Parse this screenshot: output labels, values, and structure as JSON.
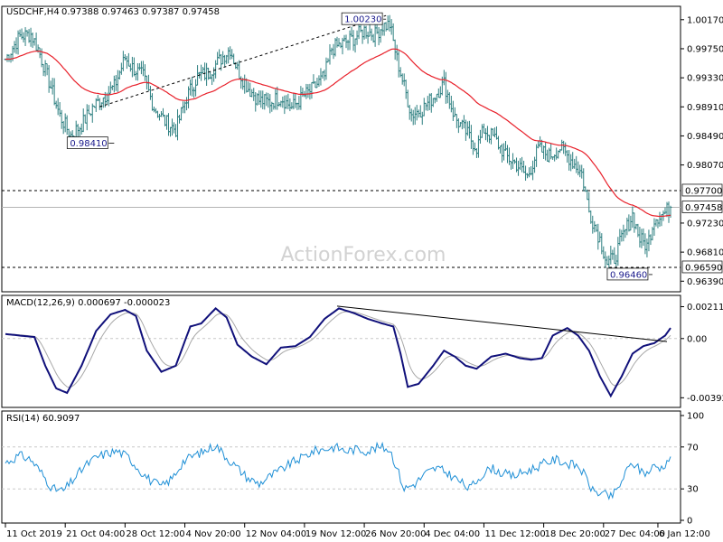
{
  "chart_data": {
    "type": "candlestick",
    "price_panel": {
      "symbol_label": "USDCHF,H4",
      "ohlc_label": "0.97388 0.97463 0.97387 0.97458",
      "watermark": "ActionForex.com",
      "ylim": [
        0.9625,
        1.0035
      ],
      "y_ticks": [
        1.0017,
        0.9975,
        0.9933,
        0.9891,
        0.9849,
        0.9807,
        0.9723,
        0.9681,
        0.9639
      ],
      "y_tick_labels": [
        "1.00170",
        "0.99750",
        "0.99330",
        "0.98910",
        "0.98490",
        "0.98070",
        "0.97230",
        "0.96810",
        "0.96390"
      ],
      "current_price": 0.97458,
      "current_price_label": "0.97458",
      "levels": [
        {
          "value": 0.977,
          "label": "0.97700"
        },
        {
          "value": 0.9659,
          "label": "0.96590"
        }
      ],
      "annotations": [
        {
          "bar": 60,
          "value": 0.9841,
          "label": "0.98410"
        },
        {
          "bar": 210,
          "value": 1.0023,
          "label": "1.00230"
        },
        {
          "bar": 357,
          "value": 0.9646,
          "label": "0.96460"
        }
      ],
      "trendline": {
        "from": {
          "bar": 52,
          "value": 0.9891
        },
        "to": {
          "bar": 210,
          "value": 1.0023
        }
      },
      "ema_color": "#e8202a",
      "bar_color": "#2d7f80",
      "close_series": [
        {
          "bar": 0,
          "value": 0.996
        },
        {
          "bar": 8,
          "value": 0.9993
        },
        {
          "bar": 14,
          "value": 0.9996
        },
        {
          "bar": 18,
          "value": 0.9975
        },
        {
          "bar": 24,
          "value": 0.9928
        },
        {
          "bar": 30,
          "value": 0.9878
        },
        {
          "bar": 36,
          "value": 0.985
        },
        {
          "bar": 42,
          "value": 0.9865
        },
        {
          "bar": 48,
          "value": 0.989
        },
        {
          "bar": 54,
          "value": 0.9905
        },
        {
          "bar": 60,
          "value": 0.992
        },
        {
          "bar": 66,
          "value": 0.9962
        },
        {
          "bar": 70,
          "value": 0.9948
        },
        {
          "bar": 76,
          "value": 0.9935
        },
        {
          "bar": 82,
          "value": 0.989
        },
        {
          "bar": 88,
          "value": 0.987
        },
        {
          "bar": 94,
          "value": 0.9858
        },
        {
          "bar": 100,
          "value": 0.9905
        },
        {
          "bar": 106,
          "value": 0.9935
        },
        {
          "bar": 112,
          "value": 0.994
        },
        {
          "bar": 118,
          "value": 0.9958
        },
        {
          "bar": 124,
          "value": 0.9975
        },
        {
          "bar": 128,
          "value": 0.9945
        },
        {
          "bar": 134,
          "value": 0.9918
        },
        {
          "bar": 140,
          "value": 0.99
        },
        {
          "bar": 146,
          "value": 0.9898
        },
        {
          "bar": 152,
          "value": 0.9905
        },
        {
          "bar": 158,
          "value": 0.989
        },
        {
          "bar": 164,
          "value": 0.9905
        },
        {
          "bar": 170,
          "value": 0.9918
        },
        {
          "bar": 176,
          "value": 0.9935
        },
        {
          "bar": 180,
          "value": 0.9975
        },
        {
          "bar": 186,
          "value": 0.9982
        },
        {
          "bar": 192,
          "value": 0.999
        },
        {
          "bar": 198,
          "value": 1.0002
        },
        {
          "bar": 204,
          "value": 0.9995
        },
        {
          "bar": 208,
          "value": 1.0008
        },
        {
          "bar": 212,
          "value": 1.001
        },
        {
          "bar": 216,
          "value": 0.996
        },
        {
          "bar": 220,
          "value": 0.992
        },
        {
          "bar": 224,
          "value": 0.988
        },
        {
          "bar": 230,
          "value": 0.9888
        },
        {
          "bar": 236,
          "value": 0.9905
        },
        {
          "bar": 242,
          "value": 0.9925
        },
        {
          "bar": 248,
          "value": 0.9875
        },
        {
          "bar": 254,
          "value": 0.9855
        },
        {
          "bar": 260,
          "value": 0.9832
        },
        {
          "bar": 264,
          "value": 0.9858
        },
        {
          "bar": 270,
          "value": 0.9845
        },
        {
          "bar": 276,
          "value": 0.982
        },
        {
          "bar": 282,
          "value": 0.9808
        },
        {
          "bar": 288,
          "value": 0.979
        },
        {
          "bar": 294,
          "value": 0.983
        },
        {
          "bar": 300,
          "value": 0.982
        },
        {
          "bar": 306,
          "value": 0.9832
        },
        {
          "bar": 312,
          "value": 0.9815
        },
        {
          "bar": 318,
          "value": 0.9795
        },
        {
          "bar": 322,
          "value": 0.974
        },
        {
          "bar": 328,
          "value": 0.97
        },
        {
          "bar": 332,
          "value": 0.9665
        },
        {
          "bar": 336,
          "value": 0.9672
        },
        {
          "bar": 340,
          "value": 0.97
        },
        {
          "bar": 346,
          "value": 0.9735
        },
        {
          "bar": 350,
          "value": 0.97
        },
        {
          "bar": 354,
          "value": 0.969
        },
        {
          "bar": 358,
          "value": 0.973
        },
        {
          "bar": 364,
          "value": 0.9738
        },
        {
          "bar": 367,
          "value": 0.97458
        }
      ]
    },
    "macd_panel": {
      "label": "MACD(12,26,9) 0.000697 -0.000023",
      "ylim": [
        -0.0045,
        0.0028
      ],
      "y_tick_labels": [
        "0.002113",
        "0.00",
        "-0.003922"
      ],
      "y_ticks": [
        0.002113,
        0.0,
        -0.003922
      ],
      "macd_line_color": "#10107a",
      "signal_line_color": "#a8a8a8",
      "trendline": {
        "from": {
          "bar": 183,
          "value": 0.00215
        },
        "to": {
          "bar": 365,
          "value": -0.0002
        }
      },
      "macd_series": [
        {
          "bar": 0,
          "value": 0.0003
        },
        {
          "bar": 8,
          "value": 0.0002
        },
        {
          "bar": 16,
          "value": 0.0001
        },
        {
          "bar": 22,
          "value": -0.0018
        },
        {
          "bar": 28,
          "value": -0.0033
        },
        {
          "bar": 34,
          "value": -0.0036
        },
        {
          "bar": 42,
          "value": -0.0018
        },
        {
          "bar": 50,
          "value": 0.0005
        },
        {
          "bar": 58,
          "value": 0.0016
        },
        {
          "bar": 66,
          "value": 0.0019
        },
        {
          "bar": 72,
          "value": 0.0015
        },
        {
          "bar": 78,
          "value": -0.0008
        },
        {
          "bar": 86,
          "value": -0.0022
        },
        {
          "bar": 94,
          "value": -0.0018
        },
        {
          "bar": 102,
          "value": 0.0008
        },
        {
          "bar": 108,
          "value": 0.001
        },
        {
          "bar": 116,
          "value": 0.002
        },
        {
          "bar": 122,
          "value": 0.0014
        },
        {
          "bar": 128,
          "value": -0.0004
        },
        {
          "bar": 136,
          "value": -0.0012
        },
        {
          "bar": 144,
          "value": -0.0017
        },
        {
          "bar": 152,
          "value": -0.0006
        },
        {
          "bar": 160,
          "value": -0.0005
        },
        {
          "bar": 168,
          "value": 0.0001
        },
        {
          "bar": 176,
          "value": 0.0013
        },
        {
          "bar": 184,
          "value": 0.002
        },
        {
          "bar": 192,
          "value": 0.0017
        },
        {
          "bar": 200,
          "value": 0.0013
        },
        {
          "bar": 208,
          "value": 0.001
        },
        {
          "bar": 214,
          "value": 0.0008
        },
        {
          "bar": 218,
          "value": -0.001
        },
        {
          "bar": 222,
          "value": -0.0032
        },
        {
          "bar": 228,
          "value": -0.003
        },
        {
          "bar": 236,
          "value": -0.0018
        },
        {
          "bar": 242,
          "value": -0.0008
        },
        {
          "bar": 248,
          "value": -0.0012
        },
        {
          "bar": 254,
          "value": -0.0018
        },
        {
          "bar": 260,
          "value": -0.002
        },
        {
          "bar": 268,
          "value": -0.0012
        },
        {
          "bar": 276,
          "value": -0.001
        },
        {
          "bar": 284,
          "value": -0.0013
        },
        {
          "bar": 290,
          "value": -0.0014
        },
        {
          "bar": 296,
          "value": -0.0013
        },
        {
          "bar": 302,
          "value": 0.0002
        },
        {
          "bar": 310,
          "value": 0.0007
        },
        {
          "bar": 316,
          "value": 0.0002
        },
        {
          "bar": 322,
          "value": -0.0008
        },
        {
          "bar": 328,
          "value": -0.0025
        },
        {
          "bar": 334,
          "value": -0.0038
        },
        {
          "bar": 340,
          "value": -0.0025
        },
        {
          "bar": 346,
          "value": -0.001
        },
        {
          "bar": 352,
          "value": -0.0005
        },
        {
          "bar": 358,
          "value": -0.0003
        },
        {
          "bar": 364,
          "value": 0.0002
        },
        {
          "bar": 367,
          "value": 0.000697
        }
      ]
    },
    "rsi_panel": {
      "label": "RSI(14) 60.9097",
      "ylim": [
        0,
        100
      ],
      "y_ticks": [
        100,
        70,
        30,
        0
      ],
      "y_tick_labels": [
        "100",
        "70",
        "30",
        "0"
      ],
      "dashed_levels": [
        70,
        30
      ],
      "line_color": "#1e8fd6",
      "rsi_series": [
        {
          "bar": 0,
          "value": 55
        },
        {
          "bar": 8,
          "value": 62
        },
        {
          "bar": 14,
          "value": 58
        },
        {
          "bar": 20,
          "value": 45
        },
        {
          "bar": 26,
          "value": 30
        },
        {
          "bar": 32,
          "value": 28
        },
        {
          "bar": 38,
          "value": 40
        },
        {
          "bar": 44,
          "value": 52
        },
        {
          "bar": 50,
          "value": 60
        },
        {
          "bar": 56,
          "value": 64
        },
        {
          "bar": 62,
          "value": 66
        },
        {
          "bar": 68,
          "value": 60
        },
        {
          "bar": 74,
          "value": 48
        },
        {
          "bar": 80,
          "value": 38
        },
        {
          "bar": 86,
          "value": 32
        },
        {
          "bar": 92,
          "value": 40
        },
        {
          "bar": 98,
          "value": 56
        },
        {
          "bar": 104,
          "value": 62
        },
        {
          "bar": 110,
          "value": 66
        },
        {
          "bar": 116,
          "value": 72
        },
        {
          "bar": 122,
          "value": 60
        },
        {
          "bar": 128,
          "value": 50
        },
        {
          "bar": 134,
          "value": 40
        },
        {
          "bar": 140,
          "value": 35
        },
        {
          "bar": 146,
          "value": 42
        },
        {
          "bar": 152,
          "value": 48
        },
        {
          "bar": 158,
          "value": 55
        },
        {
          "bar": 164,
          "value": 60
        },
        {
          "bar": 170,
          "value": 66
        },
        {
          "bar": 176,
          "value": 68
        },
        {
          "bar": 182,
          "value": 70
        },
        {
          "bar": 188,
          "value": 66
        },
        {
          "bar": 194,
          "value": 68
        },
        {
          "bar": 200,
          "value": 66
        },
        {
          "bar": 206,
          "value": 70
        },
        {
          "bar": 212,
          "value": 68
        },
        {
          "bar": 216,
          "value": 50
        },
        {
          "bar": 220,
          "value": 30
        },
        {
          "bar": 226,
          "value": 35
        },
        {
          "bar": 232,
          "value": 45
        },
        {
          "bar": 238,
          "value": 50
        },
        {
          "bar": 244,
          "value": 45
        },
        {
          "bar": 250,
          "value": 38
        },
        {
          "bar": 256,
          "value": 30
        },
        {
          "bar": 262,
          "value": 42
        },
        {
          "bar": 268,
          "value": 50
        },
        {
          "bar": 274,
          "value": 45
        },
        {
          "bar": 280,
          "value": 42
        },
        {
          "bar": 286,
          "value": 46
        },
        {
          "bar": 292,
          "value": 50
        },
        {
          "bar": 298,
          "value": 55
        },
        {
          "bar": 304,
          "value": 58
        },
        {
          "bar": 310,
          "value": 54
        },
        {
          "bar": 316,
          "value": 52
        },
        {
          "bar": 320,
          "value": 42
        },
        {
          "bar": 324,
          "value": 28
        },
        {
          "bar": 330,
          "value": 25
        },
        {
          "bar": 334,
          "value": 22
        },
        {
          "bar": 338,
          "value": 30
        },
        {
          "bar": 342,
          "value": 45
        },
        {
          "bar": 346,
          "value": 55
        },
        {
          "bar": 350,
          "value": 48
        },
        {
          "bar": 354,
          "value": 45
        },
        {
          "bar": 358,
          "value": 52
        },
        {
          "bar": 362,
          "value": 50
        },
        {
          "bar": 367,
          "value": 60.9
        }
      ]
    },
    "x_axis": {
      "bar_count": 368,
      "ticks": [
        {
          "bar": 0,
          "label": "11 Oct 2019"
        },
        {
          "bar": 33,
          "label": "21 Oct 04:00"
        },
        {
          "bar": 66,
          "label": "28 Oct 12:00"
        },
        {
          "bar": 99,
          "label": "4 Nov 20:00"
        },
        {
          "bar": 132,
          "label": "12 Nov 04:00"
        },
        {
          "bar": 165,
          "label": "19 Nov 12:00"
        },
        {
          "bar": 198,
          "label": "26 Nov 20:00"
        },
        {
          "bar": 231,
          "label": "4 Dec 04:00"
        },
        {
          "bar": 264,
          "label": "11 Dec 12:00"
        },
        {
          "bar": 297,
          "label": "18 Dec 20:00"
        },
        {
          "bar": 330,
          "label": "27 Dec 04:00"
        },
        {
          "bar": 360,
          "label": "6 Jan 12:00"
        }
      ]
    }
  }
}
